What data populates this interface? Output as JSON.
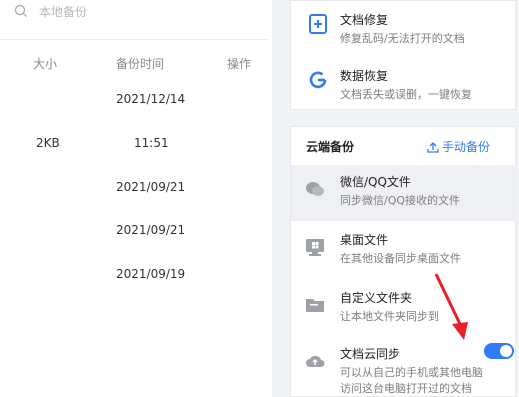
{
  "search": {
    "placeholder": "本地备份"
  },
  "table": {
    "headers": {
      "size": "大小",
      "time": "备份时间",
      "action": "操作"
    },
    "rows": [
      {
        "size": "",
        "time": "2021/12/14"
      },
      {
        "size": "2KB",
        "time": "11:51"
      },
      {
        "size": "",
        "time": "2021/09/21"
      },
      {
        "size": "",
        "time": "2021/09/21"
      },
      {
        "size": "",
        "time": "2021/09/19"
      }
    ]
  },
  "tools": [
    {
      "title": "文档修复",
      "subtitle": "修复乱码/无法打开的文档",
      "icon": "doc-repair-icon"
    },
    {
      "title": "数据恢复",
      "subtitle": "文档丢失或误删，一键恢复",
      "icon": "data-recovery-icon"
    }
  ],
  "cloud": {
    "title": "云端备份",
    "manual_button": "手动备份",
    "items": [
      {
        "title": "微信/QQ文件",
        "subtitle": "同步微信/QQ接收的文件",
        "icon": "chat-icon"
      },
      {
        "title": "桌面文件",
        "subtitle": "在其他设备同步桌面文件",
        "icon": "desktop-icon"
      },
      {
        "title": "自定义文件夹",
        "subtitle": "让本地文件夹同步到",
        "icon": "folder-icon"
      },
      {
        "title": "文档云同步",
        "subtitle": "可以从自己的手机或其他电脑",
        "subtitle2": "访问这台电脑打开过的文档",
        "icon": "cloud-upload-icon"
      }
    ],
    "sync_enabled": true
  },
  "colors": {
    "accent": "#2f7cf6",
    "annotation": "#e8202a"
  }
}
